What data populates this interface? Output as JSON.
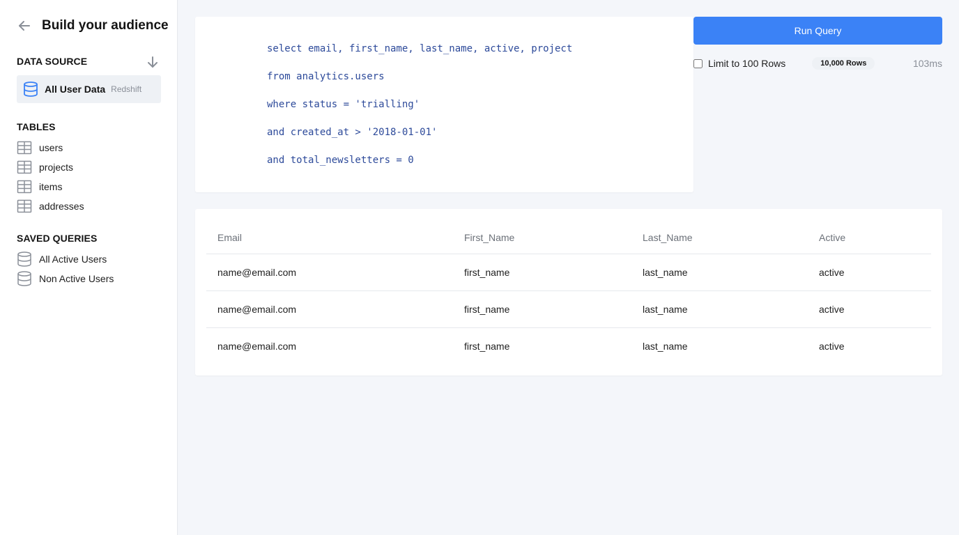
{
  "sidebar": {
    "title": "Build your audience",
    "data_source": {
      "heading": "DATA SOURCE",
      "name": "All User Data",
      "type": "Redshift"
    },
    "tables": {
      "heading": "TABLES",
      "items": [
        {
          "label": "users"
        },
        {
          "label": "projects"
        },
        {
          "label": "items"
        },
        {
          "label": "addresses"
        }
      ]
    },
    "saved_queries": {
      "heading": "SAVED QUERIES",
      "items": [
        {
          "label": "All Active Users"
        },
        {
          "label": "Non Active Users"
        }
      ]
    }
  },
  "query": {
    "lines": [
      "select email, first_name, last_name, active, project",
      "from analytics.users",
      "where status = 'trialling'",
      "and created_at > '2018-01-01'",
      "and total_newsletters = 0"
    ]
  },
  "controls": {
    "run_label": "Run Query",
    "limit_label": "Limit to 100 Rows",
    "limit_checked": false,
    "rows_badge": "10,000 Rows",
    "timing": "103ms"
  },
  "results": {
    "columns": [
      "Email",
      "First_Name",
      "Last_Name",
      "Active"
    ],
    "rows": [
      [
        "name@email.com",
        "first_name",
        "last_name",
        "active"
      ],
      [
        "name@email.com",
        "first_name",
        "last_name",
        "active"
      ],
      [
        "name@email.com",
        "first_name",
        "last_name",
        "active"
      ]
    ]
  },
  "colors": {
    "accent": "#3b82f6",
    "code": "#2d4a9a",
    "database_icon_active": "#3b82f6",
    "icon_muted": "#8a8f98"
  },
  "icons": {
    "back": "arrow-left-icon",
    "sort": "arrow-down-icon",
    "data_source": "database-icon",
    "table": "table-icon",
    "saved_query": "database-icon"
  }
}
